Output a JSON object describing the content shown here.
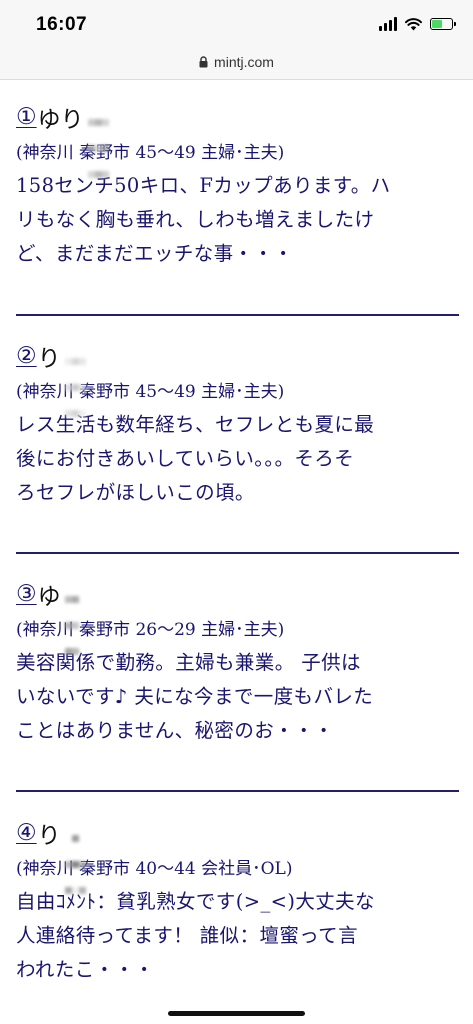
{
  "status_bar": {
    "time": "16:07"
  },
  "address_bar": {
    "domain": "mintj.com"
  },
  "entries": [
    {
      "number": "①",
      "name": "ゆり",
      "meta": "(神奈川 秦野市 45〜49 主婦･主夫)",
      "description_lines": [
        "158センチ50キロ、Fカップあります。ハ",
        "リもなく胸も垂れ、しわも増えましたけ",
        "ど、まだまだエッチな事・・・"
      ]
    },
    {
      "number": "②",
      "name": "り",
      "meta": "(神奈川 秦野市 45〜49 主婦･主夫)",
      "description_lines": [
        "レス生活も数年経ち、セフレとも夏に最",
        "後にお付きあいしていらい。。。そろそ",
        "ろセフレがほしいこの頃。"
      ]
    },
    {
      "number": "③",
      "name": "ゆ",
      "meta": "(神奈川 秦野市 26〜29 主婦･主夫)",
      "description_lines": [
        "美容関係で勤務。主婦も兼業。 子供は",
        "いないです♪ 夫にな今まで一度もバレた",
        "ことはありません、秘密のお・・・"
      ]
    },
    {
      "number": "④",
      "name": "り",
      "meta": "(神奈川 秦野市 40〜44 会社員･OL)",
      "description_lines": [
        "自由ｺﾒﾝﾄ：貧乳熟女です(>_<)大丈夫な",
        "人連絡待ってます！ 誰似：壇蜜って言",
        "われたこ・・・"
      ]
    }
  ]
}
